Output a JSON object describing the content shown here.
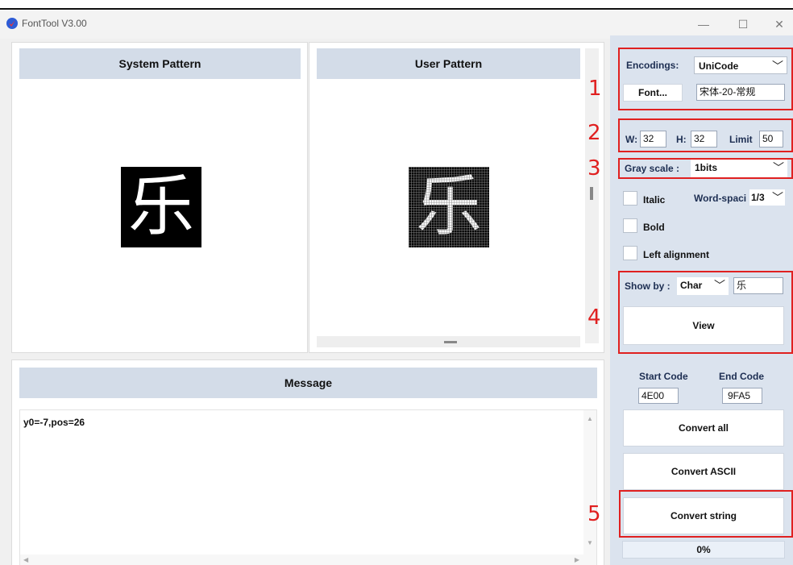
{
  "window": {
    "title": "FontTool V3.00",
    "controls": [
      "—",
      "☐",
      "✕"
    ]
  },
  "panels": {
    "system_pattern": {
      "label": "System Pattern",
      "glyph": "乐"
    },
    "user_pattern": {
      "label": "User Pattern",
      "glyph": "乐"
    },
    "message": {
      "label": "Message",
      "text": "y0=-7,pos=26"
    }
  },
  "settings": {
    "encodings_label": "Encodings:",
    "encoding_value": "UniCode",
    "font_button": "Font...",
    "font_value": "宋体-20-常规",
    "w_label": "W:",
    "w_value": "32",
    "h_label": "H:",
    "h_value": "32",
    "limit_label": "Limit",
    "limit_value": "50",
    "grayscale_label": "Gray scale :",
    "grayscale_value": "1bits",
    "italic_label": "Italic",
    "wordspacing_label": "Word-spaci",
    "wordspacing_value": "1/3",
    "bold_label": "Bold",
    "left_alignment_label": "Left alignment",
    "showby_label": "Show by :",
    "showby_value": "Char",
    "showby_input": "乐",
    "view_button": "View",
    "start_code_label": "Start Code",
    "end_code_label": "End Code",
    "start_code_value": "4E00",
    "end_code_value": "9FA5",
    "convert_all_button": "Convert all",
    "convert_ascii_button": "Convert ASCII",
    "convert_string_button": "Convert string",
    "progress_text": "0%"
  },
  "annotations": [
    "1",
    "2",
    "3",
    "4",
    "5"
  ],
  "colors": {
    "panel_header": "#d3dce8",
    "sidebar_bg": "#dbe3ee",
    "annotation": "#e02020"
  }
}
